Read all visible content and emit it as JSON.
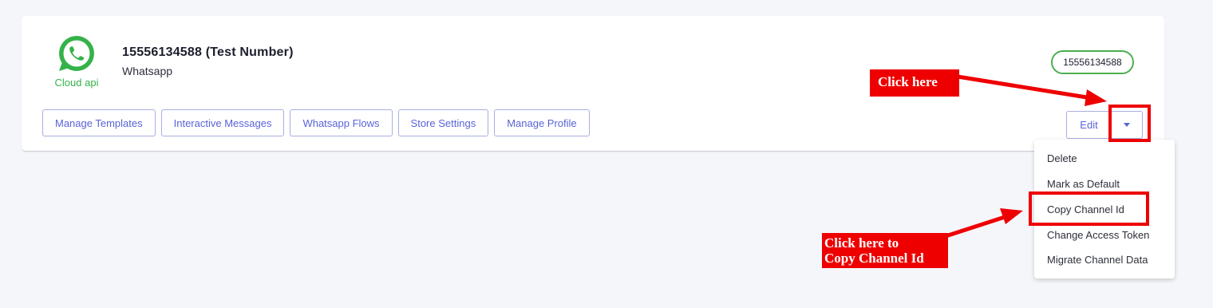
{
  "channel": {
    "logo_label": "Cloud api",
    "title": "15556134588 (Test Number)",
    "subtitle": "Whatsapp",
    "number_badge": "15556134588"
  },
  "actions": [
    {
      "label": "Manage Templates"
    },
    {
      "label": "Interactive Messages"
    },
    {
      "label": "Whatsapp Flows"
    },
    {
      "label": "Store Settings"
    },
    {
      "label": "Manage Profile"
    }
  ],
  "edit_label": "Edit",
  "dropdown": [
    {
      "label": "Delete"
    },
    {
      "label": "Mark as Default"
    },
    {
      "label": "Copy Channel Id"
    },
    {
      "label": "Change Access Token"
    },
    {
      "label": "Migrate Channel Data"
    }
  ],
  "annotations": {
    "click_here": "Click here",
    "copy_line1": "Click here to",
    "copy_line2": "Copy Channel Id"
  },
  "colors": {
    "accent": "#5964d6",
    "whatsapp_green": "#35b24a",
    "annotation_red": "#ee0000"
  },
  "icons": {
    "logo": "whatsapp-icon",
    "edit_toggle": "caret-down-icon"
  }
}
